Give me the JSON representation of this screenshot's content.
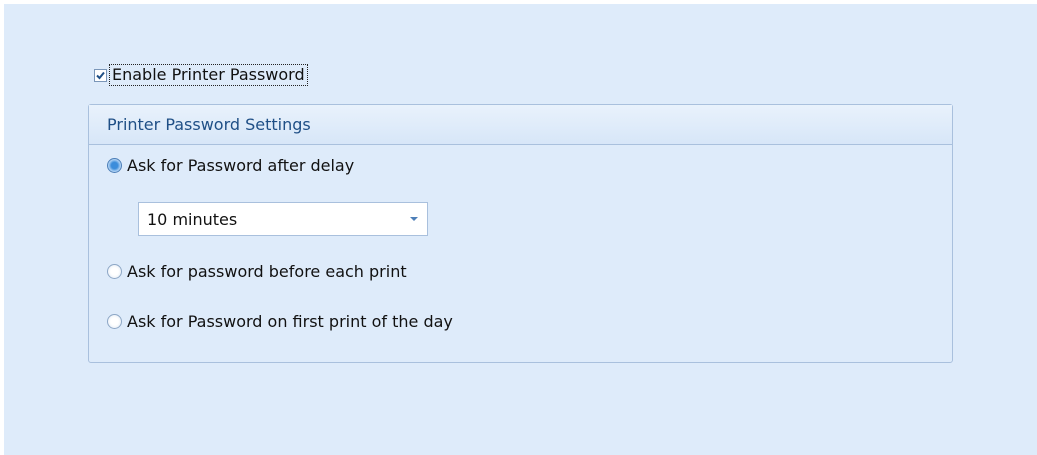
{
  "enable_password": {
    "label": "Enable Printer Password",
    "checked": true
  },
  "settings_group": {
    "title": "Printer Password Settings",
    "options": [
      {
        "label": "Ask for Password after delay",
        "selected": true
      },
      {
        "label": "Ask for password before each print",
        "selected": false
      },
      {
        "label": "Ask for Password on first print of the day",
        "selected": false
      }
    ],
    "delay_dropdown": {
      "value": "10 minutes"
    }
  },
  "colors": {
    "panel_background": "#deebfa",
    "group_header_text": "#1f4f86",
    "radio_selected": "#3c8ddb",
    "checkmark": "#1f4f86"
  },
  "icons": {
    "checkbox": "checkmark-icon",
    "dropdown": "chevron-down-icon"
  }
}
